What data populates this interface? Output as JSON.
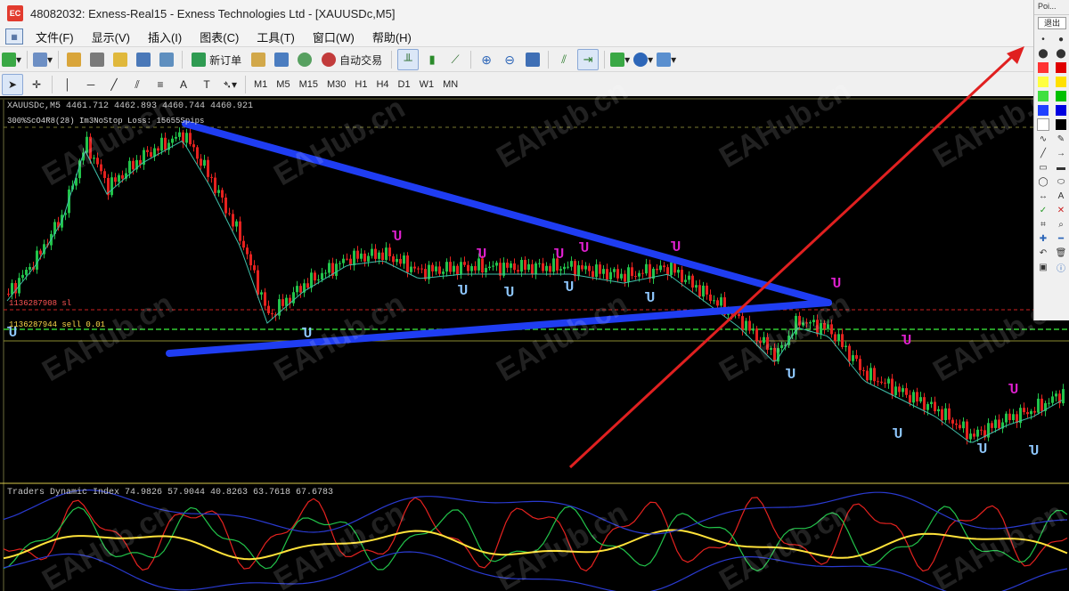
{
  "window": {
    "title": "48082032: Exness-Real15 - Exness Technologies Ltd - [XAUUSDc,M5]",
    "app_icon": "EC"
  },
  "menu": [
    "文件(F)",
    "显示(V)",
    "插入(I)",
    "图表(C)",
    "工具(T)",
    "窗口(W)",
    "帮助(H)"
  ],
  "toolbar": {
    "new_order_label": "新订单",
    "auto_trade_label": "自动交易"
  },
  "timeframes": [
    "M1",
    "M5",
    "M15",
    "M30",
    "H1",
    "H4",
    "D1",
    "W1",
    "MN"
  ],
  "chart": {
    "symbol_line": "XAUUSDc,M5  4461.712 4462.893 4460.744 4460.921",
    "info_line": "300%ScO4R8(28) Im3NoStop Loss:  15655Spips",
    "sl_line_1": "1136287908 sl",
    "sl_line_2": "1136287944 sell 0.01",
    "indicator_line": "Traders Dynamic Index 74.9826 57.9044 40.8263 63.7618 67.6783",
    "watermark": "EAHub.cn",
    "colors": {
      "bull": "#22c34a",
      "bear": "#e5221f",
      "ma": "#3fbfa8",
      "trendline": "#1f3df2",
      "arrow": "#e02020"
    }
  },
  "right_panel": {
    "title": "Poi...",
    "exit_label": "退出",
    "swatches": [
      "#ff3333",
      "#e00000",
      "#ffff40",
      "#ffe000",
      "#40e040",
      "#00c000",
      "#2040ff",
      "#0000e0",
      "#ffffff",
      "#000000"
    ]
  }
}
